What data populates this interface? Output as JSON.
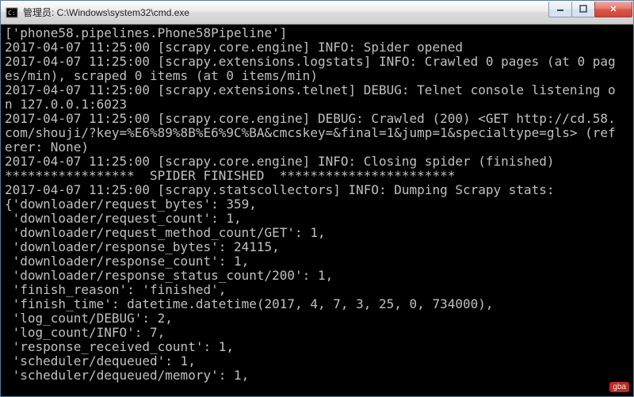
{
  "window": {
    "title": "管理员: C:\\Windows\\system32\\cmd.exe",
    "icon_glyph": "cmd"
  },
  "controls": {
    "minimize": "─",
    "maximize": "□",
    "close": "X"
  },
  "terminal": {
    "lines": [
      "['phone58.pipelines.Phone58Pipeline']",
      "2017-04-07 11:25:00 [scrapy.core.engine] INFO: Spider opened",
      "2017-04-07 11:25:00 [scrapy.extensions.logstats] INFO: Crawled 0 pages (at 0 pag",
      "es/min), scraped 0 items (at 0 items/min)",
      "2017-04-07 11:25:00 [scrapy.extensions.telnet] DEBUG: Telnet console listening o",
      "n 127.0.0.1:6023",
      "2017-04-07 11:25:00 [scrapy.core.engine] DEBUG: Crawled (200) <GET http://cd.58.",
      "com/shouji/?key=%E6%89%8B%E6%9C%BA&cmcskey=&final=1&jump=1&specialtype=gls> (ref",
      "erer: None)",
      "2017-04-07 11:25:00 [scrapy.core.engine] INFO: Closing spider (finished)",
      "*****************  SPIDER FINISHED  ***********************",
      "2017-04-07 11:25:00 [scrapy.statscollectors] INFO: Dumping Scrapy stats:",
      "{'downloader/request_bytes': 359,",
      " 'downloader/request_count': 1,",
      " 'downloader/request_method_count/GET': 1,",
      " 'downloader/response_bytes': 24115,",
      " 'downloader/response_count': 1,",
      " 'downloader/response_status_count/200': 1,",
      " 'finish_reason': 'finished',",
      " 'finish_time': datetime.datetime(2017, 4, 7, 3, 25, 0, 734000),",
      " 'log_count/DEBUG': 2,",
      " 'log_count/INFO': 7,",
      " 'response_received_count': 1,",
      " 'scheduler/dequeued': 1,",
      " 'scheduler/dequeued/memory': 1,"
    ]
  },
  "watermark": "gba"
}
